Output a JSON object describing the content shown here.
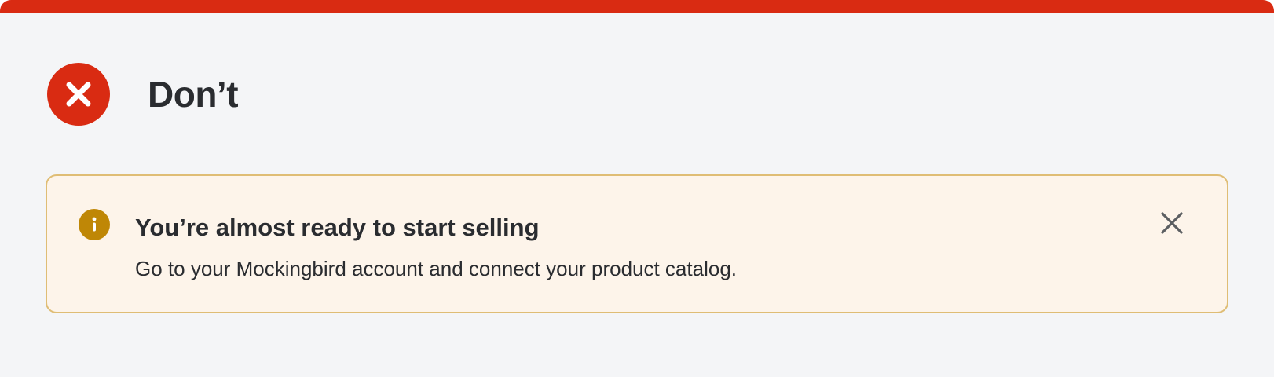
{
  "verdict": {
    "title": "Don’t",
    "icon": "close-circle-icon",
    "color": "#d92b12"
  },
  "banner": {
    "title": "You’re almost ready to start selling",
    "body": "Go to your Mockingbird account and connect your product catalog.",
    "icon": "info-icon",
    "dismiss_icon": "close-icon",
    "background": "#fdf4ea",
    "border": "#dfbd75",
    "icon_color": "#bf8706"
  }
}
